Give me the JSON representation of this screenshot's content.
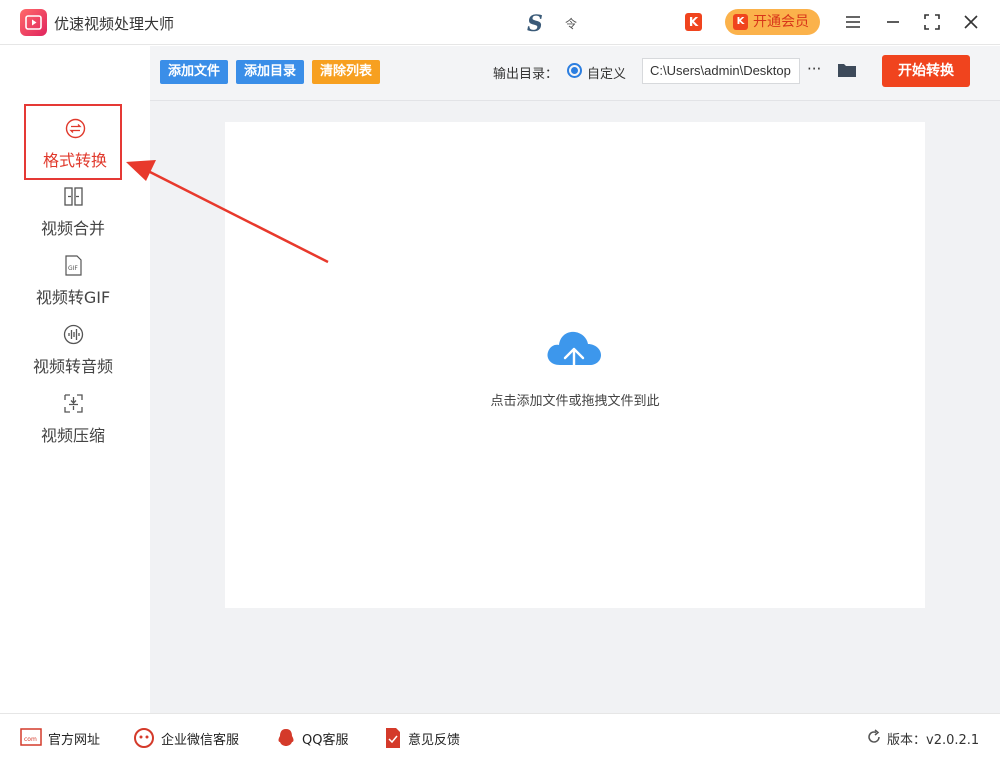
{
  "app": {
    "title": "优速视频处理大师",
    "center_extra": "令",
    "k_badge": "K",
    "vip_label": "开通会员"
  },
  "sidebar": {
    "items": [
      {
        "label": "格式转换",
        "icon": "format-convert-icon",
        "active": true
      },
      {
        "label": "视频合并",
        "icon": "video-merge-icon",
        "active": false
      },
      {
        "label": "视频转GIF",
        "icon": "gif-icon",
        "active": false
      },
      {
        "label": "视频转音频",
        "icon": "audio-icon",
        "active": false
      },
      {
        "label": "视频压缩",
        "icon": "compress-icon",
        "active": false
      }
    ]
  },
  "toolbar": {
    "add_file": "添加文件",
    "add_folder": "添加目录",
    "clear_list": "清除列表",
    "output_label": "输出目录：",
    "custom_option": "自定义",
    "output_path": "C:\\Users\\admin\\Desktop",
    "more": "···",
    "start": "开始转换"
  },
  "dropzone": {
    "hint": "点击添加文件或拖拽文件到此"
  },
  "footer": {
    "website": "官方网址",
    "wechat": "企业微信客服",
    "qq": "QQ客服",
    "feedback": "意见反馈",
    "version": "版本：v2.0.2.1"
  },
  "colors": {
    "accent_red": "#f0441e",
    "button_blue": "#3a8ee8",
    "button_orange": "#f7a020",
    "cloud_blue": "#3d97ec",
    "active_red": "#e53935"
  }
}
